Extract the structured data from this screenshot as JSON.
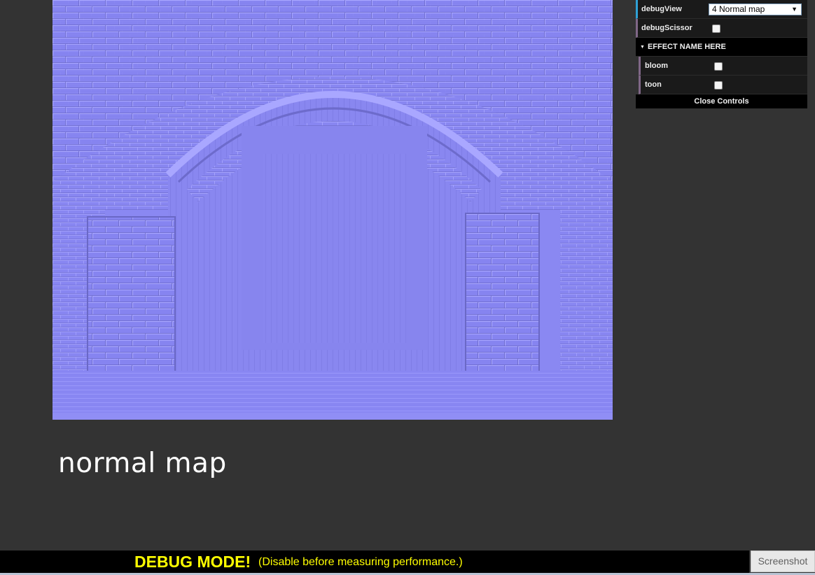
{
  "viewport": {
    "scene": "normal-map-render",
    "base_color": "#8a88f2"
  },
  "caption": "normal map",
  "gui": {
    "controls": [
      {
        "label": "debugView",
        "type": "select",
        "value": "4 Normal map"
      },
      {
        "label": "debugScissor",
        "type": "checkbox",
        "checked": false
      }
    ],
    "folder": {
      "title": "EFFECT NAME HERE",
      "items": [
        {
          "label": "bloom",
          "type": "checkbox",
          "checked": false
        },
        {
          "label": "toon",
          "type": "checkbox",
          "checked": false
        }
      ]
    },
    "close_label": "Close Controls"
  },
  "debug_banner": {
    "strong": "DEBUG MODE!",
    "small": "(Disable before measuring performance.)",
    "color": "#ffff00"
  },
  "screenshot_button": "Screenshot"
}
